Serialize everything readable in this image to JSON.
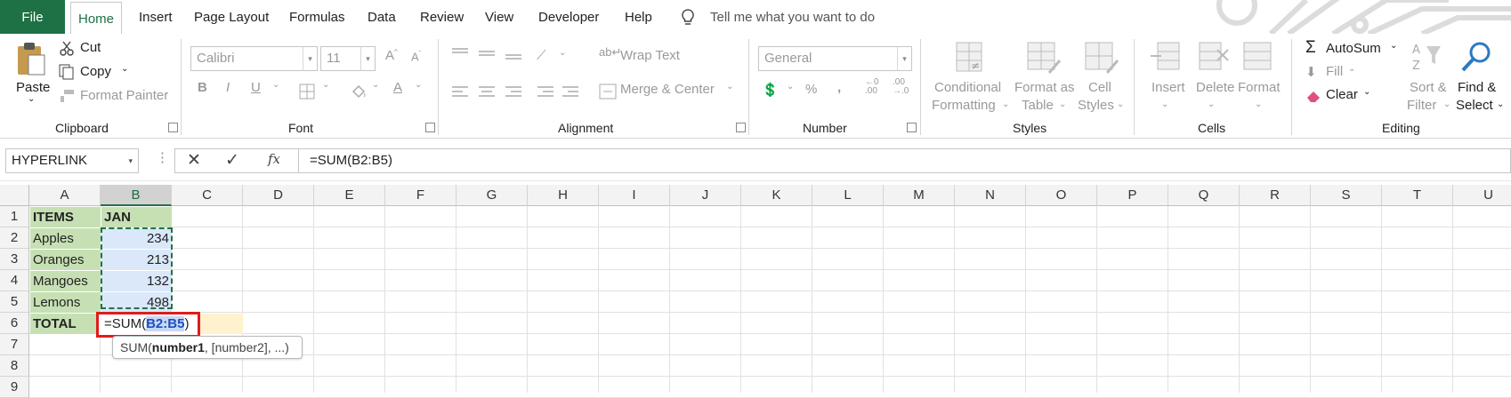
{
  "tabs": [
    "File",
    "Home",
    "Insert",
    "Page Layout",
    "Formulas",
    "Data",
    "Review",
    "View",
    "Developer",
    "Help"
  ],
  "tellme": "Tell me what you want to do",
  "clipboard": {
    "paste": "Paste",
    "cut": "Cut",
    "copy": "Copy",
    "format_painter": "Format Painter",
    "group": "Clipboard"
  },
  "font": {
    "name": "Calibri",
    "size": "11",
    "bold": "B",
    "italic": "I",
    "underline": "U",
    "group": "Font"
  },
  "alignment": {
    "wrap": "Wrap Text",
    "merge": "Merge & Center",
    "group": "Alignment"
  },
  "number": {
    "format": "General",
    "group": "Number"
  },
  "styles": {
    "conditional": [
      "Conditional",
      "Formatting"
    ],
    "format_table": [
      "Format as",
      "Table"
    ],
    "cell_styles": [
      "Cell",
      "Styles"
    ],
    "group": "Styles"
  },
  "cells": {
    "insert": "Insert",
    "delete": "Delete",
    "format": "Format",
    "group": "Cells"
  },
  "editing": {
    "autosum": "AutoSum",
    "fill": "Fill",
    "clear": "Clear",
    "sort": [
      "Sort &",
      "Filter"
    ],
    "find": [
      "Find &",
      "Select"
    ],
    "group": "Editing"
  },
  "formula_bar": {
    "name_box": "HYPERLINK",
    "formula": "=SUM(B2:B5)",
    "fx": "fx"
  },
  "sheet": {
    "columns": [
      "A",
      "B",
      "C",
      "D",
      "E",
      "F",
      "G",
      "H",
      "I",
      "J",
      "K",
      "L",
      "M",
      "N",
      "O",
      "P",
      "Q",
      "R",
      "S",
      "T",
      "U"
    ],
    "rows": [
      "1",
      "2",
      "3",
      "4",
      "5",
      "6",
      "7",
      "8",
      "9"
    ],
    "data": [
      [
        "ITEMS",
        "JAN"
      ],
      [
        "Apples",
        "234"
      ],
      [
        "Oranges",
        "213"
      ],
      [
        "Mangoes",
        "132"
      ],
      [
        "Lemons",
        "498"
      ],
      [
        "TOTAL",
        ""
      ]
    ],
    "editing_formula": {
      "prefix": "=SUM(",
      "ref": "B2:B5",
      "suffix": ")"
    },
    "tooltip": {
      "fn": "SUM(",
      "arg": "number1",
      "rest": ", [number2], ...)"
    }
  },
  "colors": {
    "accent": "#217346",
    "file_tab": "#1e7145",
    "header_fill": "#c6e0b4",
    "range_fill": "#dae8fa",
    "highlight_box": "#e01c1c",
    "total_row_fill": "#fff2cc"
  }
}
